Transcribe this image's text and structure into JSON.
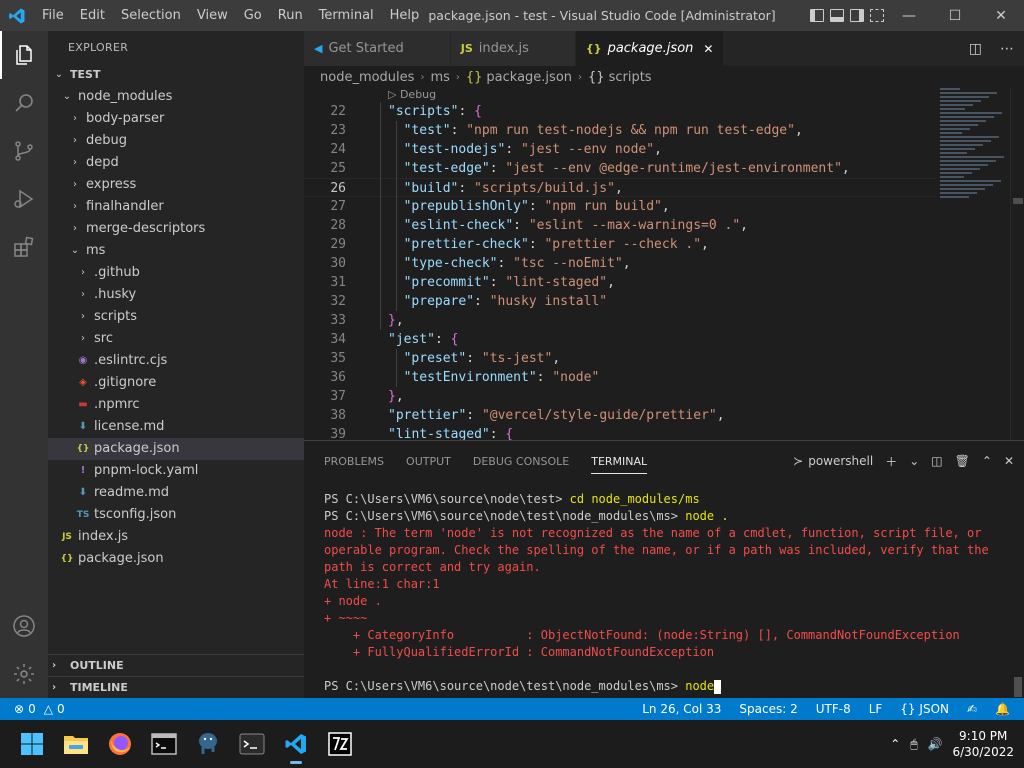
{
  "titlebar": {
    "menu": [
      "File",
      "Edit",
      "Selection",
      "View",
      "Go",
      "Run",
      "Terminal",
      "Help"
    ],
    "title": "package.json - test - Visual Studio Code [Administrator]"
  },
  "sidebar": {
    "header": "EXPLORER",
    "root": "TEST",
    "items": [
      {
        "label": "node_modules",
        "depth": 1,
        "type": "folder-open"
      },
      {
        "label": "body-parser",
        "depth": 2,
        "type": "folder"
      },
      {
        "label": "debug",
        "depth": 2,
        "type": "folder"
      },
      {
        "label": "depd",
        "depth": 2,
        "type": "folder"
      },
      {
        "label": "express",
        "depth": 2,
        "type": "folder"
      },
      {
        "label": "finalhandler",
        "depth": 2,
        "type": "folder"
      },
      {
        "label": "merge-descriptors",
        "depth": 2,
        "type": "folder"
      },
      {
        "label": "ms",
        "depth": 2,
        "type": "folder-open"
      },
      {
        "label": ".github",
        "depth": 3,
        "type": "folder"
      },
      {
        "label": ".husky",
        "depth": 3,
        "type": "folder"
      },
      {
        "label": "scripts",
        "depth": 3,
        "type": "folder"
      },
      {
        "label": "src",
        "depth": 3,
        "type": "folder"
      },
      {
        "label": ".eslintrc.cjs",
        "depth": 3,
        "type": "eslint"
      },
      {
        "label": ".gitignore",
        "depth": 3,
        "type": "git"
      },
      {
        "label": ".npmrc",
        "depth": 3,
        "type": "npm"
      },
      {
        "label": "license.md",
        "depth": 3,
        "type": "md"
      },
      {
        "label": "package.json",
        "depth": 3,
        "type": "json",
        "selected": true
      },
      {
        "label": "pnpm-lock.yaml",
        "depth": 3,
        "type": "yaml"
      },
      {
        "label": "readme.md",
        "depth": 3,
        "type": "md"
      },
      {
        "label": "tsconfig.json",
        "depth": 3,
        "type": "ts"
      },
      {
        "label": "index.js",
        "depth": 1,
        "type": "js"
      },
      {
        "label": "package.json",
        "depth": 1,
        "type": "json"
      }
    ],
    "outline": "OUTLINE",
    "timeline": "TIMELINE"
  },
  "tabs": [
    {
      "label": "Get Started",
      "icon": "VS",
      "active": false
    },
    {
      "label": "index.js",
      "icon": "JS",
      "active": false
    },
    {
      "label": "package.json",
      "icon": "{}",
      "active": true,
      "close": "✕"
    }
  ],
  "breadcrumb": [
    "node_modules",
    "ms",
    "package.json",
    "scripts"
  ],
  "breadcrumb_icon": "{}",
  "codelens": "▷ Debug",
  "code": [
    {
      "n": "22",
      "indent": 1,
      "key": "\"scripts\"",
      "tail": ": {",
      "brace": "b1"
    },
    {
      "n": "23",
      "indent": 2,
      "key": "\"test\"",
      "val": "\"npm run test-nodejs && npm run test-edge\"",
      "comma": ","
    },
    {
      "n": "24",
      "indent": 2,
      "key": "\"test-nodejs\"",
      "val": "\"jest --env node\"",
      "comma": ","
    },
    {
      "n": "25",
      "indent": 2,
      "key": "\"test-edge\"",
      "val": "\"jest --env @edge-runtime/jest-environment\"",
      "comma": ","
    },
    {
      "n": "26",
      "indent": 2,
      "key": "\"build\"",
      "val": "\"scripts/build.js\"",
      "comma": ",",
      "current": true
    },
    {
      "n": "27",
      "indent": 2,
      "key": "\"prepublishOnly\"",
      "val": "\"npm run build\"",
      "comma": ","
    },
    {
      "n": "28",
      "indent": 2,
      "key": "\"eslint-check\"",
      "val": "\"eslint --max-warnings=0 .\"",
      "comma": ","
    },
    {
      "n": "29",
      "indent": 2,
      "key": "\"prettier-check\"",
      "val": "\"prettier --check .\"",
      "comma": ","
    },
    {
      "n": "30",
      "indent": 2,
      "key": "\"type-check\"",
      "val": "\"tsc --noEmit\"",
      "comma": ","
    },
    {
      "n": "31",
      "indent": 2,
      "key": "\"precommit\"",
      "val": "\"lint-staged\"",
      "comma": ","
    },
    {
      "n": "32",
      "indent": 2,
      "key": "\"prepare\"",
      "val": "\"husky install\"",
      "comma": ""
    },
    {
      "n": "33",
      "indent": 1,
      "close": "}",
      "brace": "b1",
      "comma": ","
    },
    {
      "n": "34",
      "indent": 1,
      "key": "\"jest\"",
      "tail": ": {",
      "brace": "b1"
    },
    {
      "n": "35",
      "indent": 2,
      "key": "\"preset\"",
      "val": "\"ts-jest\"",
      "comma": ","
    },
    {
      "n": "36",
      "indent": 2,
      "key": "\"testEnvironment\"",
      "val": "\"node\"",
      "comma": ""
    },
    {
      "n": "37",
      "indent": 1,
      "close": "}",
      "brace": "b1",
      "comma": ","
    },
    {
      "n": "38",
      "indent": 1,
      "key": "\"prettier\"",
      "val": "\"@vercel/style-guide/prettier\"",
      "comma": ","
    },
    {
      "n": "39",
      "indent": 1,
      "key": "\"lint-staged\"",
      "tail": ": {",
      "brace": "b1"
    }
  ],
  "panel": {
    "tabs": [
      "PROBLEMS",
      "OUTPUT",
      "DEBUG CONSOLE",
      "TERMINAL"
    ],
    "active_tab": "TERMINAL",
    "shell": "powershell"
  },
  "terminal": [
    {
      "t": "PS C:\\Users\\VM6\\source\\node\\test> ",
      "cmd": "cd node_modules/ms"
    },
    {
      "t": "PS C:\\Users\\VM6\\source\\node\\test\\node_modules\\ms> ",
      "cmd": "node ."
    },
    {
      "t": "node : The term 'node' is not recognized as the name of a cmdlet, function, script file, or",
      "err": true
    },
    {
      "t": "operable program. Check the spelling of the name, or if a path was included, verify that the",
      "err": true
    },
    {
      "t": "path is correct and try again.",
      "err": true
    },
    {
      "t": "At line:1 char:1",
      "err": true
    },
    {
      "t": "+ node .",
      "err": true
    },
    {
      "t": "+ ~~~~",
      "err": true
    },
    {
      "t": "    + CategoryInfo          : ObjectNotFound: (node:String) [], CommandNotFoundException",
      "err": true
    },
    {
      "t": "    + FullyQualifiedErrorId : CommandNotFoundException",
      "err": true
    },
    {
      "t": "",
      "blank": true
    },
    {
      "t": "PS C:\\Users\\VM6\\source\\node\\test\\node_modules\\ms> ",
      "cmd": "node",
      "cursor": true
    }
  ],
  "status": {
    "errors": "0",
    "warnings": "0",
    "position": "Ln 26, Col 33",
    "spaces": "Spaces: 2",
    "encoding": "UTF-8",
    "eol": "LF",
    "language": "JSON",
    "language_icon": "{}"
  },
  "taskbar": {
    "time": "9:10 PM",
    "date": "6/30/2022"
  },
  "colors": {
    "accent": "#007acc",
    "error_text": "#f14c4c",
    "command_text": "#e5e510"
  }
}
